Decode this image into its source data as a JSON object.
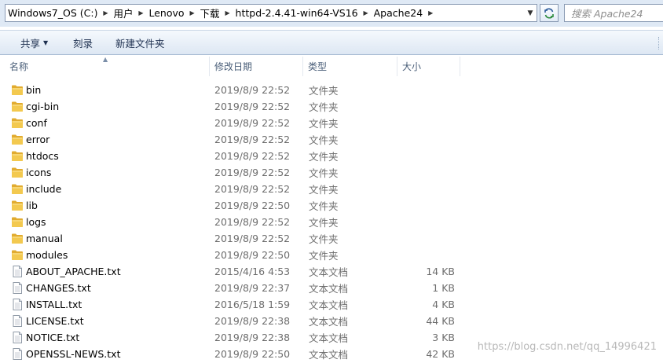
{
  "address": {
    "crumbs": [
      "Windows7_OS (C:)",
      "用户",
      "Lenovo",
      "下载",
      "httpd-2.4.41-win64-VS16",
      "Apache24"
    ]
  },
  "search": {
    "placeholder": "搜索 Apache24"
  },
  "toolbar": {
    "share_label": "共享",
    "burn_label": "刻录",
    "new_folder_label": "新建文件夹"
  },
  "columns": {
    "name": "名称",
    "date": "修改日期",
    "type": "类型",
    "size": "大小"
  },
  "files": [
    {
      "name": "bin",
      "date": "2019/8/9 22:52",
      "type": "文件夹",
      "size": "",
      "icon": "folder-icon"
    },
    {
      "name": "cgi-bin",
      "date": "2019/8/9 22:52",
      "type": "文件夹",
      "size": "",
      "icon": "folder-icon"
    },
    {
      "name": "conf",
      "date": "2019/8/9 22:52",
      "type": "文件夹",
      "size": "",
      "icon": "folder-icon"
    },
    {
      "name": "error",
      "date": "2019/8/9 22:52",
      "type": "文件夹",
      "size": "",
      "icon": "folder-icon"
    },
    {
      "name": "htdocs",
      "date": "2019/8/9 22:52",
      "type": "文件夹",
      "size": "",
      "icon": "folder-icon"
    },
    {
      "name": "icons",
      "date": "2019/8/9 22:52",
      "type": "文件夹",
      "size": "",
      "icon": "folder-icon"
    },
    {
      "name": "include",
      "date": "2019/8/9 22:52",
      "type": "文件夹",
      "size": "",
      "icon": "folder-icon"
    },
    {
      "name": "lib",
      "date": "2019/8/9 22:50",
      "type": "文件夹",
      "size": "",
      "icon": "folder-icon"
    },
    {
      "name": "logs",
      "date": "2019/8/9 22:52",
      "type": "文件夹",
      "size": "",
      "icon": "folder-icon"
    },
    {
      "name": "manual",
      "date": "2019/8/9 22:52",
      "type": "文件夹",
      "size": "",
      "icon": "folder-icon"
    },
    {
      "name": "modules",
      "date": "2019/8/9 22:50",
      "type": "文件夹",
      "size": "",
      "icon": "folder-icon"
    },
    {
      "name": "ABOUT_APACHE.txt",
      "date": "2015/4/16 4:53",
      "type": "文本文档",
      "size": "14 KB",
      "icon": "text-file-icon"
    },
    {
      "name": "CHANGES.txt",
      "date": "2019/8/9 22:37",
      "type": "文本文档",
      "size": "1 KB",
      "icon": "text-file-icon"
    },
    {
      "name": "INSTALL.txt",
      "date": "2016/5/18 1:59",
      "type": "文本文档",
      "size": "4 KB",
      "icon": "text-file-icon"
    },
    {
      "name": "LICENSE.txt",
      "date": "2019/8/9 22:38",
      "type": "文本文档",
      "size": "44 KB",
      "icon": "text-file-icon"
    },
    {
      "name": "NOTICE.txt",
      "date": "2019/8/9 22:38",
      "type": "文本文档",
      "size": "3 KB",
      "icon": "text-file-icon"
    },
    {
      "name": "OPENSSL-NEWS.txt",
      "date": "2019/8/9 22:50",
      "type": "文本文档",
      "size": "42 KB",
      "icon": "text-file-icon"
    }
  ],
  "watermark": "https://blog.csdn.net/qq_14996421",
  "colors": {
    "addressbar_bg": "#dfe9f5",
    "folder": "#e8b93c",
    "header_text": "#4c607a",
    "toolbar_text": "#1e3050"
  }
}
